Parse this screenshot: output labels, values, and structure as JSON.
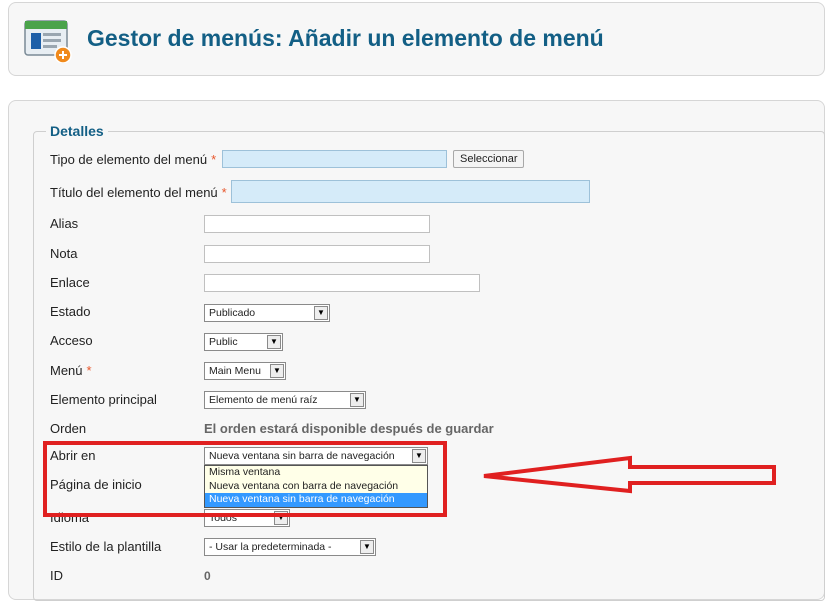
{
  "header": {
    "title": "Gestor de menús: Añadir un elemento de menú"
  },
  "details": {
    "legend": "Detalles",
    "fields": {
      "tipo": {
        "label": "Tipo de elemento del menú",
        "value": "",
        "button": "Seleccionar"
      },
      "titulo": {
        "label": "Título del elemento del menú",
        "value": ""
      },
      "alias": {
        "label": "Alias",
        "value": ""
      },
      "nota": {
        "label": "Nota",
        "value": ""
      },
      "enlace": {
        "label": "Enlace",
        "value": ""
      },
      "estado": {
        "label": "Estado",
        "selected": "Publicado"
      },
      "acceso": {
        "label": "Acceso",
        "selected": "Public"
      },
      "menu": {
        "label": "Menú",
        "selected": "Main Menu"
      },
      "principal": {
        "label": "Elemento principal",
        "selected": "Elemento de menú raíz"
      },
      "orden": {
        "label": "Orden",
        "text": "El orden estará disponible después de guardar"
      },
      "abrir": {
        "label": "Abrir en",
        "selected": "Nueva ventana sin barra de navegación",
        "options": [
          "Misma ventana",
          "Nueva ventana con barra de navegación",
          "Nueva ventana sin barra de navegación"
        ]
      },
      "inicio": {
        "label": "Página de inicio"
      },
      "idioma": {
        "label": "Idioma",
        "selected": "Todos"
      },
      "estilo": {
        "label": "Estilo de la plantilla",
        "selected": "- Usar la predeterminada -"
      },
      "id": {
        "label": "ID",
        "value": "0"
      }
    },
    "required_mark": "*"
  },
  "colors": {
    "title": "#135f85",
    "required_bg": "#d5ebf9",
    "annotation": "#e02020",
    "option_highlight": "#3399ff"
  },
  "icons": {
    "header": "menu-manager-add-icon",
    "dropdown": "chevron-down-icon"
  }
}
